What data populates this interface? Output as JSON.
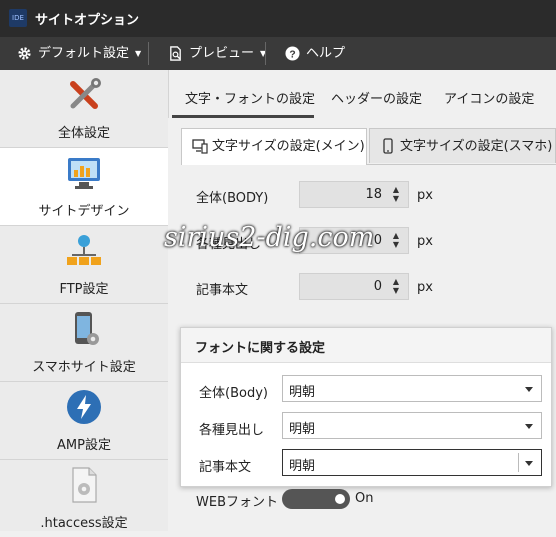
{
  "window": {
    "title": "サイトオプション",
    "app_icon": "app-icon"
  },
  "menubar": {
    "items": [
      {
        "label": "デフォルト設定",
        "icon": "gear-icon"
      },
      {
        "label": "プレビュー",
        "icon": "preview-icon"
      },
      {
        "label": "ヘルプ",
        "icon": "help-icon"
      }
    ]
  },
  "sidebar": {
    "items": [
      {
        "label": "全体設定",
        "icon": "tools-icon"
      },
      {
        "label": "サイトデザイン",
        "icon": "monitor-chart-icon"
      },
      {
        "label": "FTP設定",
        "icon": "network-icon"
      },
      {
        "label": "スマホサイト設定",
        "icon": "smartphone-gear-icon"
      },
      {
        "label": "AMP設定",
        "icon": "amp-bolt-icon"
      },
      {
        "label": ".htaccess設定",
        "icon": "file-gear-icon"
      }
    ],
    "active": 1
  },
  "tabs": [
    {
      "label": "文字・フォントの設定"
    },
    {
      "label": "ヘッダーの設定"
    },
    {
      "label": "アイコンの設定"
    }
  ],
  "subtabs": [
    {
      "label": "文字サイズの設定(メイン)",
      "icon": "desktop-mobile-icon"
    },
    {
      "label": "文字サイズの設定(スマホ)",
      "icon": "smartphone-icon"
    }
  ],
  "font_sizes": [
    {
      "label": "全体(BODY)",
      "value": "18",
      "unit": "px"
    },
    {
      "label": "各種見出し",
      "value": "0",
      "unit": "px"
    },
    {
      "label": "記事本文",
      "value": "0",
      "unit": "px"
    }
  ],
  "font_panel": {
    "title": "フォントに関する設定",
    "rows": [
      {
        "label": "全体(Body)",
        "value": "明朝"
      },
      {
        "label": "各種見出し",
        "value": "明朝"
      },
      {
        "label": "記事本文",
        "value": "明朝"
      }
    ]
  },
  "webfont": {
    "label": "WEBフォント",
    "state": "On"
  },
  "watermark": "sirius2-dig.com",
  "colors": {
    "titlebar": "#2b2b2b",
    "menubar": "#3a3a3a",
    "amp_blue": "#2d6fb5"
  }
}
